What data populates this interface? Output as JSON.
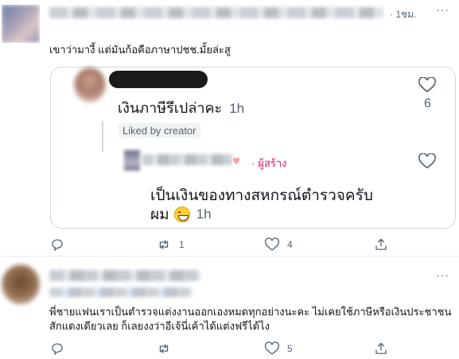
{
  "tweet1": {
    "meta": "· 1ชม.",
    "more": "···",
    "text": "เขาว่ามางี้ แต่มันก้อคือภาษาปชช.มั้ยล่ะสู",
    "quote": {
      "question": "เงินภาษีรึเปล่าคะ",
      "question_time": "1h",
      "liked_label": "Liked by creator",
      "like_count": "6",
      "reply": {
        "heart": "♥",
        "creator_dot": "·",
        "creator_label": "ผู้สร้าง",
        "line1": "เป็นเงินของทางสหกรณ์ตำรวจครับ",
        "line2": "ผม",
        "time": "1h"
      }
    },
    "actions": {
      "retweets": "1",
      "likes": "4"
    }
  },
  "tweet2": {
    "more": "···",
    "text": "พี่ชายแฟนเราเป็นตำรวจแต่งงานออกเองหมดทุกอย่างนะคะ ไม่เคยใช้ภาษีหรือเงินประชาชนสักแดงเดียวเลย ก็เลยงงว่าอีเจ้นี่เค้าได้แต่งฟรีได้ไง",
    "actions": {
      "likes": "5"
    }
  },
  "colors": {
    "secondary": "#536471",
    "border": "#cfd9de",
    "creator": "#e0245e",
    "heart_pink": "#f4a0a8"
  }
}
